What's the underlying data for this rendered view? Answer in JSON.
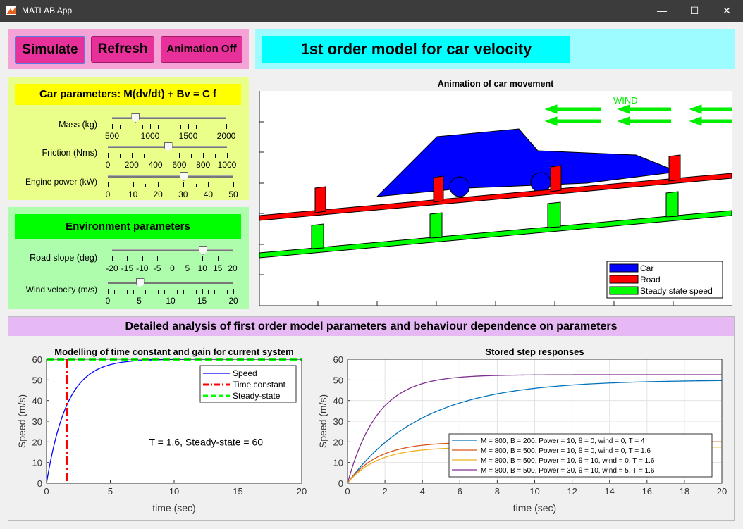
{
  "window": {
    "title": "MATLAB App",
    "minimize_glyph": "—",
    "maximize_glyph": "☐",
    "close_glyph": "✕"
  },
  "toolbar": {
    "simulate": "Simulate",
    "refresh": "Refresh",
    "animation": "Animation Off"
  },
  "header": {
    "title": "1st order model for car velocity"
  },
  "car_params": {
    "title": "Car parameters: M(dv/dt) + Bv = C f",
    "mass": {
      "label": "Mass (kg)",
      "ticks": [
        "500",
        "1000",
        "1500",
        "2000"
      ],
      "value": 800,
      "min": 500,
      "max": 2000
    },
    "friction": {
      "label": "Friction (Nms)",
      "ticks": [
        "0",
        "200",
        "400",
        "600",
        "800",
        "1000"
      ],
      "value": 500,
      "min": 0,
      "max": 1000
    },
    "power": {
      "label": "Engine power (kW)",
      "ticks": [
        "0",
        "10",
        "20",
        "30",
        "40",
        "50"
      ],
      "value": 30,
      "min": 0,
      "max": 50
    }
  },
  "env_params": {
    "title": "Environment parameters",
    "slope": {
      "label": "Road slope (deg)",
      "ticks": [
        "-20",
        "-15",
        "-10",
        "-5",
        "0",
        "5",
        "10",
        "15",
        "20"
      ],
      "value": 10,
      "min": -20,
      "max": 20
    },
    "wind": {
      "label": "Wind velocity (m/s)",
      "ticks": [
        "0",
        "5",
        "10",
        "15",
        "20"
      ],
      "value": 5,
      "min": 0,
      "max": 20
    }
  },
  "animation": {
    "title": "Animation of car movement",
    "wind_label": "WIND",
    "legend": [
      "Car",
      "Road",
      "Steady state speed"
    ],
    "colors": {
      "car": "#0000ff",
      "road": "#ff0000",
      "steady": "#00ff00"
    }
  },
  "analysis": {
    "title": "Detailed analysis of first order model parameters and behaviour dependence on parameters"
  },
  "chart_data": [
    {
      "type": "line",
      "title": "Modelling of time constant and gain for current system",
      "xlabel": "time (sec)",
      "ylabel": "Speed (m/s)",
      "xlim": [
        0,
        20
      ],
      "ylim": [
        0,
        60
      ],
      "xticks": [
        "0",
        "5",
        "10",
        "15",
        "20"
      ],
      "yticks": [
        "0",
        "10",
        "20",
        "30",
        "40",
        "50",
        "60"
      ],
      "annotation": "T = 1.6, Steady-state = 60",
      "series": [
        {
          "name": "Speed",
          "color": "#0000ff",
          "style": "solid",
          "gain": 60,
          "tau": 1.6
        },
        {
          "name": "Time constant",
          "color": "#ff0000",
          "style": "dashdot",
          "x": 1.6
        },
        {
          "name": "Steady-state",
          "color": "#00ff00",
          "style": "dashed",
          "y": 60
        }
      ],
      "legend_position": "top-right"
    },
    {
      "type": "line",
      "title": "Stored step responses",
      "xlabel": "time (sec)",
      "ylabel": "Speed (m/s)",
      "xlim": [
        0,
        20
      ],
      "ylim": [
        0,
        60
      ],
      "xticks": [
        "0",
        "2",
        "4",
        "6",
        "8",
        "10",
        "12",
        "14",
        "16",
        "18",
        "20"
      ],
      "yticks": [
        "0",
        "10",
        "20",
        "30",
        "40",
        "50",
        "60"
      ],
      "grid": true,
      "series": [
        {
          "name": "M = 800, B = 200, Power = 10, θ = 0, wind = 0, T = 4",
          "color": "#0072bd",
          "gain": 50,
          "tau": 4
        },
        {
          "name": "M = 800, B = 500, Power = 10, θ = 0, wind = 0, T = 1.6",
          "color": "#d95319",
          "gain": 20,
          "tau": 1.6
        },
        {
          "name": "M = 800, B = 500, Power = 10, θ = 10, wind = 0, T = 1.6",
          "color": "#edb120",
          "gain": 17.5,
          "tau": 1.6
        },
        {
          "name": "M = 800, B = 500, Power = 30, θ = 10, wind = 5, T = 1.6",
          "color": "#7e2f8e",
          "gain": 52.5,
          "tau": 1.6
        }
      ],
      "legend_position": "bottom-right"
    }
  ]
}
